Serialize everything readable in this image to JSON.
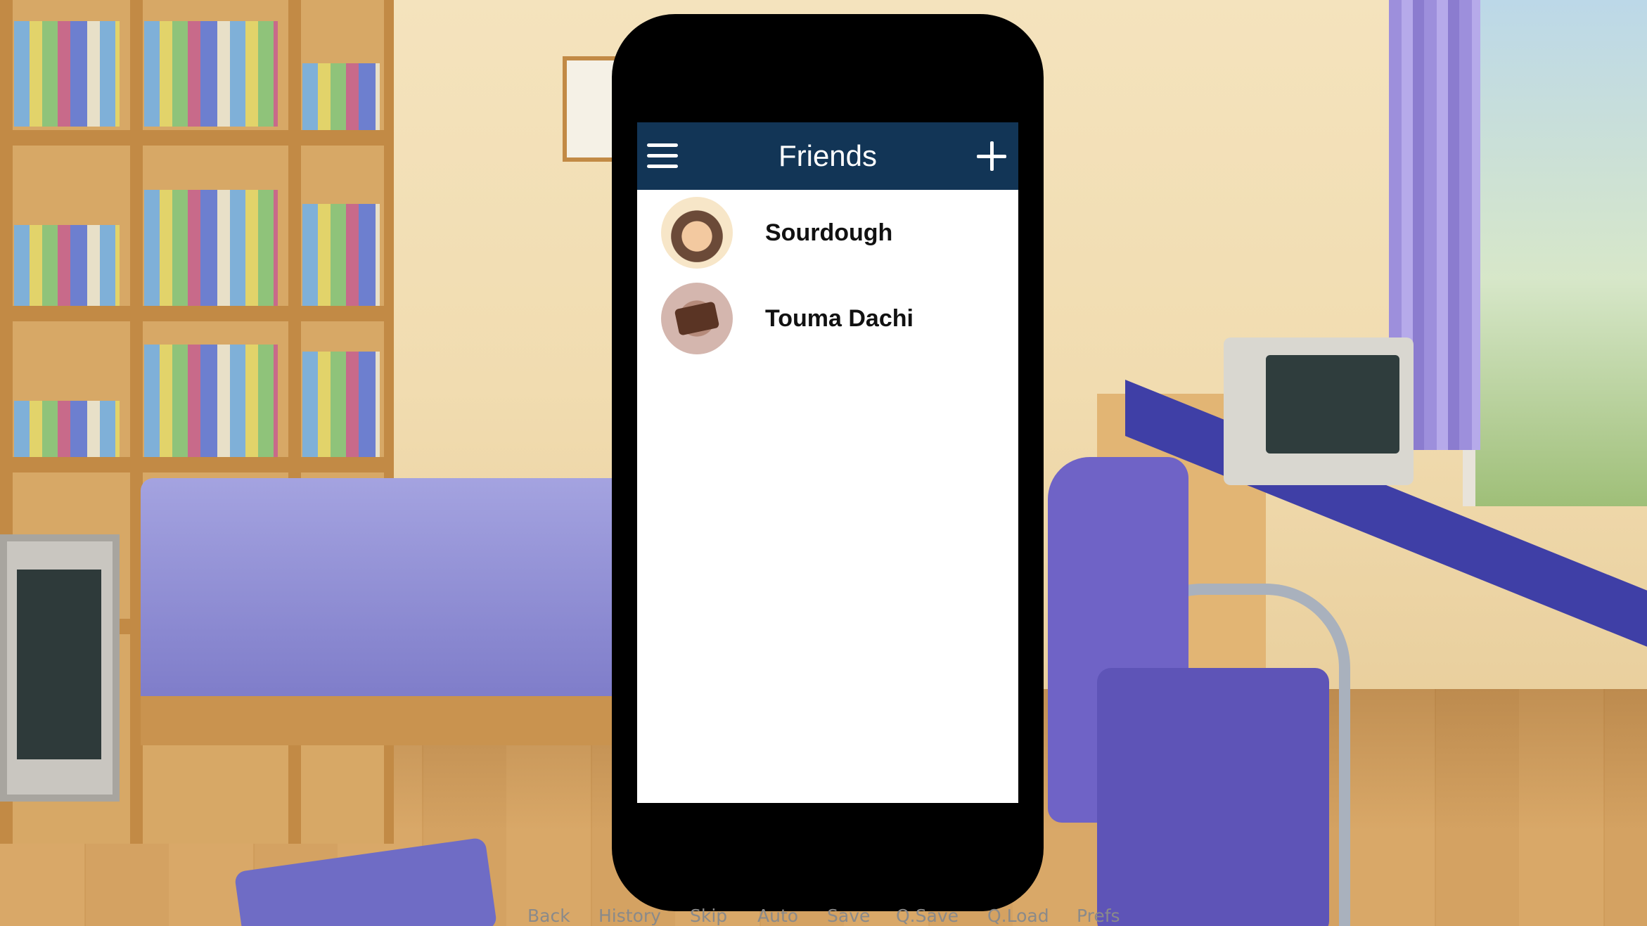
{
  "scene": {
    "description_icon": "bedroom-background"
  },
  "phone": {
    "header": {
      "title": "Friends",
      "menu_icon": "hamburger-menu-icon",
      "add_icon": "plus-icon",
      "background_color": "#123556"
    },
    "friends": [
      {
        "name": "Sourdough",
        "avatar_icon": "sourdough-avatar"
      },
      {
        "name": "Touma Dachi",
        "avatar_icon": "touma-dachi-avatar"
      }
    ]
  },
  "quick_menu": {
    "items": [
      "Back",
      "History",
      "Skip",
      "Auto",
      "Save",
      "Q.Save",
      "Q.Load",
      "Prefs"
    ],
    "text_color": "#8a8a8a"
  }
}
